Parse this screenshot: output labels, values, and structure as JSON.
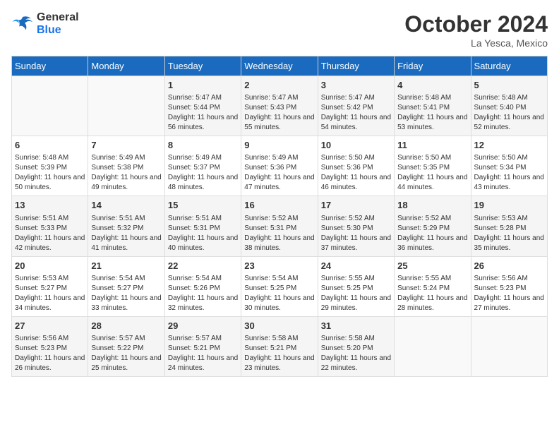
{
  "logo": {
    "line1": "General",
    "line2": "Blue"
  },
  "title": "October 2024",
  "location": "La Yesca, Mexico",
  "headers": [
    "Sunday",
    "Monday",
    "Tuesday",
    "Wednesday",
    "Thursday",
    "Friday",
    "Saturday"
  ],
  "weeks": [
    [
      {
        "day": "",
        "info": ""
      },
      {
        "day": "",
        "info": ""
      },
      {
        "day": "1",
        "info": "Sunrise: 5:47 AM\nSunset: 5:44 PM\nDaylight: 11 hours and 56 minutes."
      },
      {
        "day": "2",
        "info": "Sunrise: 5:47 AM\nSunset: 5:43 PM\nDaylight: 11 hours and 55 minutes."
      },
      {
        "day": "3",
        "info": "Sunrise: 5:47 AM\nSunset: 5:42 PM\nDaylight: 11 hours and 54 minutes."
      },
      {
        "day": "4",
        "info": "Sunrise: 5:48 AM\nSunset: 5:41 PM\nDaylight: 11 hours and 53 minutes."
      },
      {
        "day": "5",
        "info": "Sunrise: 5:48 AM\nSunset: 5:40 PM\nDaylight: 11 hours and 52 minutes."
      }
    ],
    [
      {
        "day": "6",
        "info": "Sunrise: 5:48 AM\nSunset: 5:39 PM\nDaylight: 11 hours and 50 minutes."
      },
      {
        "day": "7",
        "info": "Sunrise: 5:49 AM\nSunset: 5:38 PM\nDaylight: 11 hours and 49 minutes."
      },
      {
        "day": "8",
        "info": "Sunrise: 5:49 AM\nSunset: 5:37 PM\nDaylight: 11 hours and 48 minutes."
      },
      {
        "day": "9",
        "info": "Sunrise: 5:49 AM\nSunset: 5:36 PM\nDaylight: 11 hours and 47 minutes."
      },
      {
        "day": "10",
        "info": "Sunrise: 5:50 AM\nSunset: 5:36 PM\nDaylight: 11 hours and 46 minutes."
      },
      {
        "day": "11",
        "info": "Sunrise: 5:50 AM\nSunset: 5:35 PM\nDaylight: 11 hours and 44 minutes."
      },
      {
        "day": "12",
        "info": "Sunrise: 5:50 AM\nSunset: 5:34 PM\nDaylight: 11 hours and 43 minutes."
      }
    ],
    [
      {
        "day": "13",
        "info": "Sunrise: 5:51 AM\nSunset: 5:33 PM\nDaylight: 11 hours and 42 minutes."
      },
      {
        "day": "14",
        "info": "Sunrise: 5:51 AM\nSunset: 5:32 PM\nDaylight: 11 hours and 41 minutes."
      },
      {
        "day": "15",
        "info": "Sunrise: 5:51 AM\nSunset: 5:31 PM\nDaylight: 11 hours and 40 minutes."
      },
      {
        "day": "16",
        "info": "Sunrise: 5:52 AM\nSunset: 5:31 PM\nDaylight: 11 hours and 38 minutes."
      },
      {
        "day": "17",
        "info": "Sunrise: 5:52 AM\nSunset: 5:30 PM\nDaylight: 11 hours and 37 minutes."
      },
      {
        "day": "18",
        "info": "Sunrise: 5:52 AM\nSunset: 5:29 PM\nDaylight: 11 hours and 36 minutes."
      },
      {
        "day": "19",
        "info": "Sunrise: 5:53 AM\nSunset: 5:28 PM\nDaylight: 11 hours and 35 minutes."
      }
    ],
    [
      {
        "day": "20",
        "info": "Sunrise: 5:53 AM\nSunset: 5:27 PM\nDaylight: 11 hours and 34 minutes."
      },
      {
        "day": "21",
        "info": "Sunrise: 5:54 AM\nSunset: 5:27 PM\nDaylight: 11 hours and 33 minutes."
      },
      {
        "day": "22",
        "info": "Sunrise: 5:54 AM\nSunset: 5:26 PM\nDaylight: 11 hours and 32 minutes."
      },
      {
        "day": "23",
        "info": "Sunrise: 5:54 AM\nSunset: 5:25 PM\nDaylight: 11 hours and 30 minutes."
      },
      {
        "day": "24",
        "info": "Sunrise: 5:55 AM\nSunset: 5:25 PM\nDaylight: 11 hours and 29 minutes."
      },
      {
        "day": "25",
        "info": "Sunrise: 5:55 AM\nSunset: 5:24 PM\nDaylight: 11 hours and 28 minutes."
      },
      {
        "day": "26",
        "info": "Sunrise: 5:56 AM\nSunset: 5:23 PM\nDaylight: 11 hours and 27 minutes."
      }
    ],
    [
      {
        "day": "27",
        "info": "Sunrise: 5:56 AM\nSunset: 5:23 PM\nDaylight: 11 hours and 26 minutes."
      },
      {
        "day": "28",
        "info": "Sunrise: 5:57 AM\nSunset: 5:22 PM\nDaylight: 11 hours and 25 minutes."
      },
      {
        "day": "29",
        "info": "Sunrise: 5:57 AM\nSunset: 5:21 PM\nDaylight: 11 hours and 24 minutes."
      },
      {
        "day": "30",
        "info": "Sunrise: 5:58 AM\nSunset: 5:21 PM\nDaylight: 11 hours and 23 minutes."
      },
      {
        "day": "31",
        "info": "Sunrise: 5:58 AM\nSunset: 5:20 PM\nDaylight: 11 hours and 22 minutes."
      },
      {
        "day": "",
        "info": ""
      },
      {
        "day": "",
        "info": ""
      }
    ]
  ]
}
